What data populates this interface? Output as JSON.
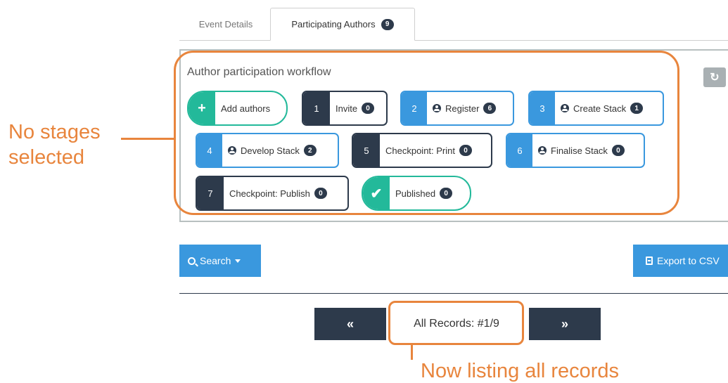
{
  "tabs": [
    {
      "label": "Event Details"
    },
    {
      "label": "Participating Authors",
      "badge": "9"
    }
  ],
  "workflow": {
    "title": "Author participation workflow",
    "refresh_icon": "refresh-icon",
    "stages": [
      {
        "num": "+",
        "label": "Add authors",
        "count": "",
        "style": "green"
      },
      {
        "num": "1",
        "label": "Invite",
        "count": "0",
        "style": "dark",
        "user_icon": false
      },
      {
        "num": "2",
        "label": "Register",
        "count": "6",
        "style": "blue",
        "user_icon": true
      },
      {
        "num": "3",
        "label": "Create Stack",
        "count": "1",
        "style": "blue",
        "user_icon": true
      },
      {
        "num": "4",
        "label": "Develop Stack",
        "count": "2",
        "style": "blue",
        "user_icon": true
      },
      {
        "num": "5",
        "label": "Checkpoint: Print",
        "count": "0",
        "style": "dark",
        "user_icon": false
      },
      {
        "num": "6",
        "label": "Finalise Stack",
        "count": "0",
        "style": "blue",
        "user_icon": true
      },
      {
        "num": "7",
        "label": "Checkpoint: Publish",
        "count": "0",
        "style": "dark",
        "user_icon": false
      },
      {
        "num": "✔",
        "label": "Published",
        "count": "0",
        "style": "green"
      }
    ]
  },
  "toolbar": {
    "search_label": "Search",
    "export_label": "Export to CSV"
  },
  "pager": {
    "prev": "«",
    "next": "»",
    "records": "All Records:  #1/9"
  },
  "annotations": {
    "left": "No stages selected",
    "bottom": "Now listing all records"
  },
  "colors": {
    "dark": "#2d3a4b",
    "blue": "#3a98de",
    "green": "#23b99a",
    "annotation": "#e8853d"
  }
}
